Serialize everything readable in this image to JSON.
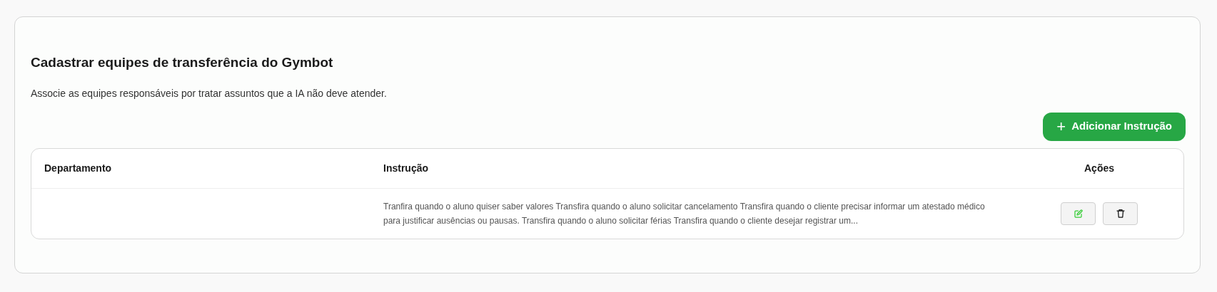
{
  "header": {
    "title": "Cadastrar equipes de transferência do Gymbot",
    "description": "Associe as equipes responsáveis por tratar assuntos que a IA não deve atender."
  },
  "add_button": {
    "icon": "+",
    "label": "Adicionar Instrução"
  },
  "table": {
    "columns": [
      "Departamento",
      "Instrução",
      "Ações"
    ],
    "rows": [
      {
        "department": "",
        "instruction": "Tranfira quando o aluno quiser saber valores Transfira quando o aluno solicitar cancelamento Transfira quando o cliente precisar informar um atestado médico para justificar ausências ou pausas. Transfira quando o aluno solicitar férias Transfira quando o cliente desejar registrar um..."
      }
    ]
  }
}
